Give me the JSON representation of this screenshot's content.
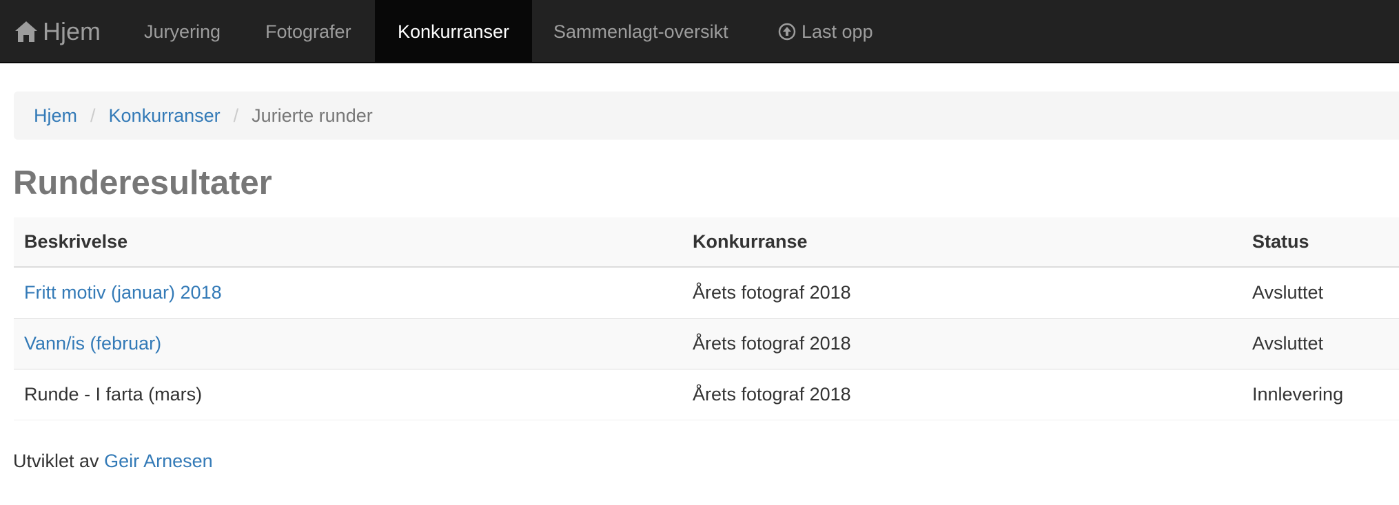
{
  "navbar": {
    "brand": "Hjem",
    "items": [
      {
        "label": "Juryering"
      },
      {
        "label": "Fotografer"
      },
      {
        "label": "Konkurranser"
      },
      {
        "label": "Sammenlagt-oversikt"
      },
      {
        "label": "Last opp"
      }
    ]
  },
  "breadcrumb": {
    "items": [
      "Hjem",
      "Konkurranser"
    ],
    "separator": "/",
    "current": "Jurierte runder"
  },
  "page_title": "Runderesultater",
  "table": {
    "headers": [
      "Beskrivelse",
      "Konkurranse",
      "Status"
    ],
    "rows": [
      {
        "description": "Fritt motiv (januar) 2018",
        "competition": "Årets fotograf 2018",
        "status": "Avsluttet"
      },
      {
        "description": "Vann/is (februar)",
        "competition": "Årets fotograf 2018",
        "status": "Avsluttet"
      },
      {
        "description": "Runde - I farta (mars)",
        "competition": "Årets fotograf 2018",
        "status": "Innlevering"
      }
    ]
  },
  "footer": {
    "prefix": "Utviklet av",
    "author": "Geir Arnesen"
  },
  "icons": {
    "brand": "home-icon",
    "upload": "upload-circle-icon"
  },
  "colors": {
    "navbar_bg": "#222222",
    "link": "#337ab7",
    "active_nav_bg": "#080808"
  }
}
